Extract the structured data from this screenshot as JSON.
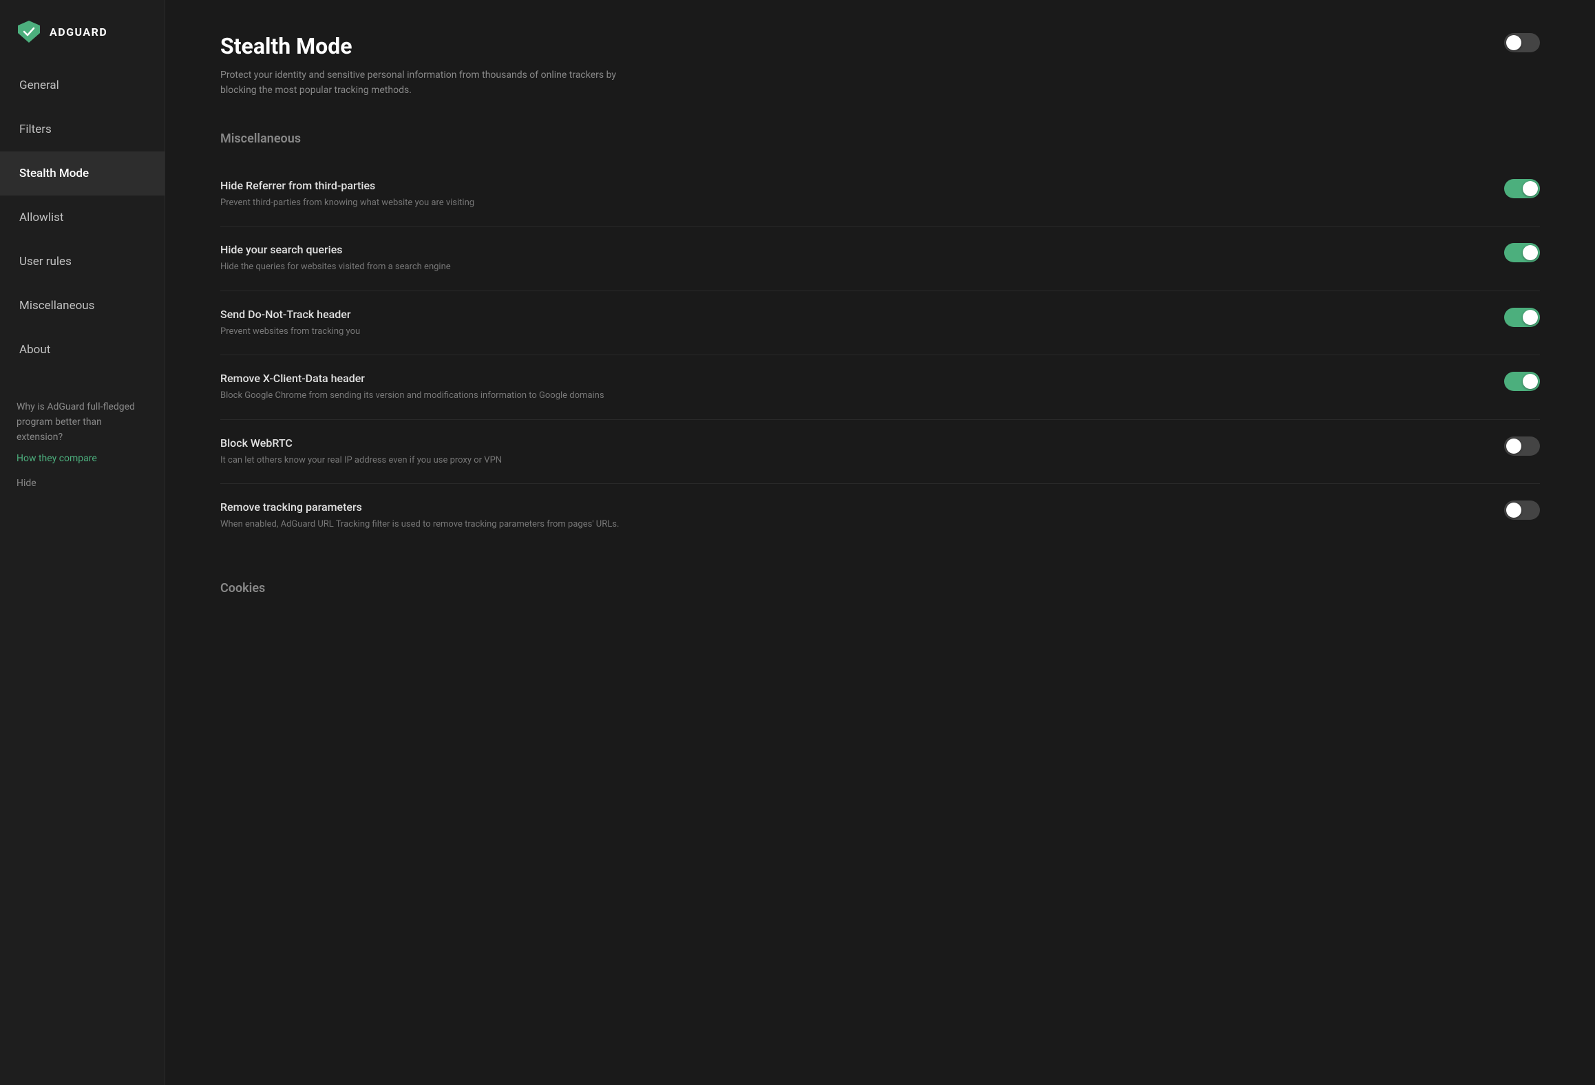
{
  "logo": {
    "text": "ADGUARD"
  },
  "sidebar": {
    "nav_items": [
      {
        "label": "General",
        "id": "general",
        "active": false
      },
      {
        "label": "Filters",
        "id": "filters",
        "active": false
      },
      {
        "label": "Stealth Mode",
        "id": "stealth-mode",
        "active": true
      },
      {
        "label": "Allowlist",
        "id": "allowlist",
        "active": false
      },
      {
        "label": "User rules",
        "id": "user-rules",
        "active": false
      },
      {
        "label": "Miscellaneous",
        "id": "miscellaneous",
        "active": false
      },
      {
        "label": "About",
        "id": "about",
        "active": false
      }
    ],
    "promo": {
      "text": "Why is AdGuard full-fledged program better than extension?",
      "link_text": "How they compare",
      "hide_label": "Hide"
    }
  },
  "main": {
    "title": "Stealth Mode",
    "description": "Protect your identity and sensitive personal information from thousands of online trackers by blocking the most popular tracking methods.",
    "master_toggle": false,
    "sections": [
      {
        "id": "miscellaneous",
        "heading": "Miscellaneous",
        "settings": [
          {
            "id": "hide-referrer",
            "title": "Hide Referrer from third-parties",
            "description": "Prevent third-parties from knowing what website you are visiting",
            "enabled": true
          },
          {
            "id": "hide-search-queries",
            "title": "Hide your search queries",
            "description": "Hide the queries for websites visited from a search engine",
            "enabled": true
          },
          {
            "id": "send-dnt-header",
            "title": "Send Do-Not-Track header",
            "description": "Prevent websites from tracking you",
            "enabled": true
          },
          {
            "id": "remove-x-client-data",
            "title": "Remove X-Client-Data header",
            "description": "Block Google Chrome from sending its version and modifications information to Google domains",
            "enabled": true
          },
          {
            "id": "block-webrtc",
            "title": "Block WebRTC",
            "description": "It can let others know your real IP address even if you use proxy or VPN",
            "enabled": false
          },
          {
            "id": "remove-tracking-params",
            "title": "Remove tracking parameters",
            "description": "When enabled, AdGuard URL Tracking filter is used to remove tracking parameters from pages' URLs.",
            "enabled": false
          }
        ]
      },
      {
        "id": "cookies",
        "heading": "Cookies",
        "settings": []
      }
    ]
  }
}
